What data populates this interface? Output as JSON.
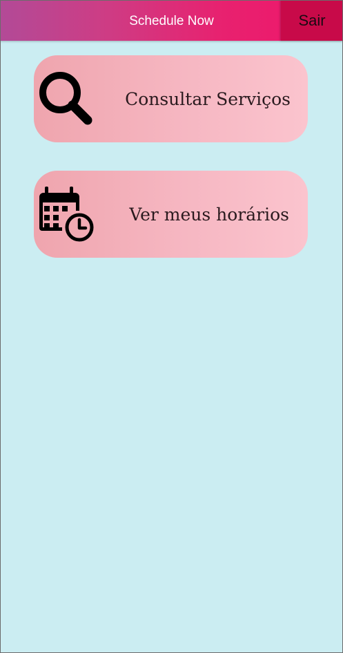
{
  "header": {
    "title": "Schedule Now",
    "logout_label": "Sair"
  },
  "menu": {
    "items": [
      {
        "label": "Consultar Serviços",
        "icon": "search-icon"
      },
      {
        "label": "Ver meus horários",
        "icon": "calendar-clock-icon"
      }
    ]
  },
  "colors": {
    "background": "#cbedf2",
    "header_gradient_start": "#b24a97",
    "header_gradient_end": "#f0156a",
    "logout_button": "#c80a49",
    "card_gradient_start": "#efa5ae",
    "card_gradient_end": "#fbc4ce"
  }
}
